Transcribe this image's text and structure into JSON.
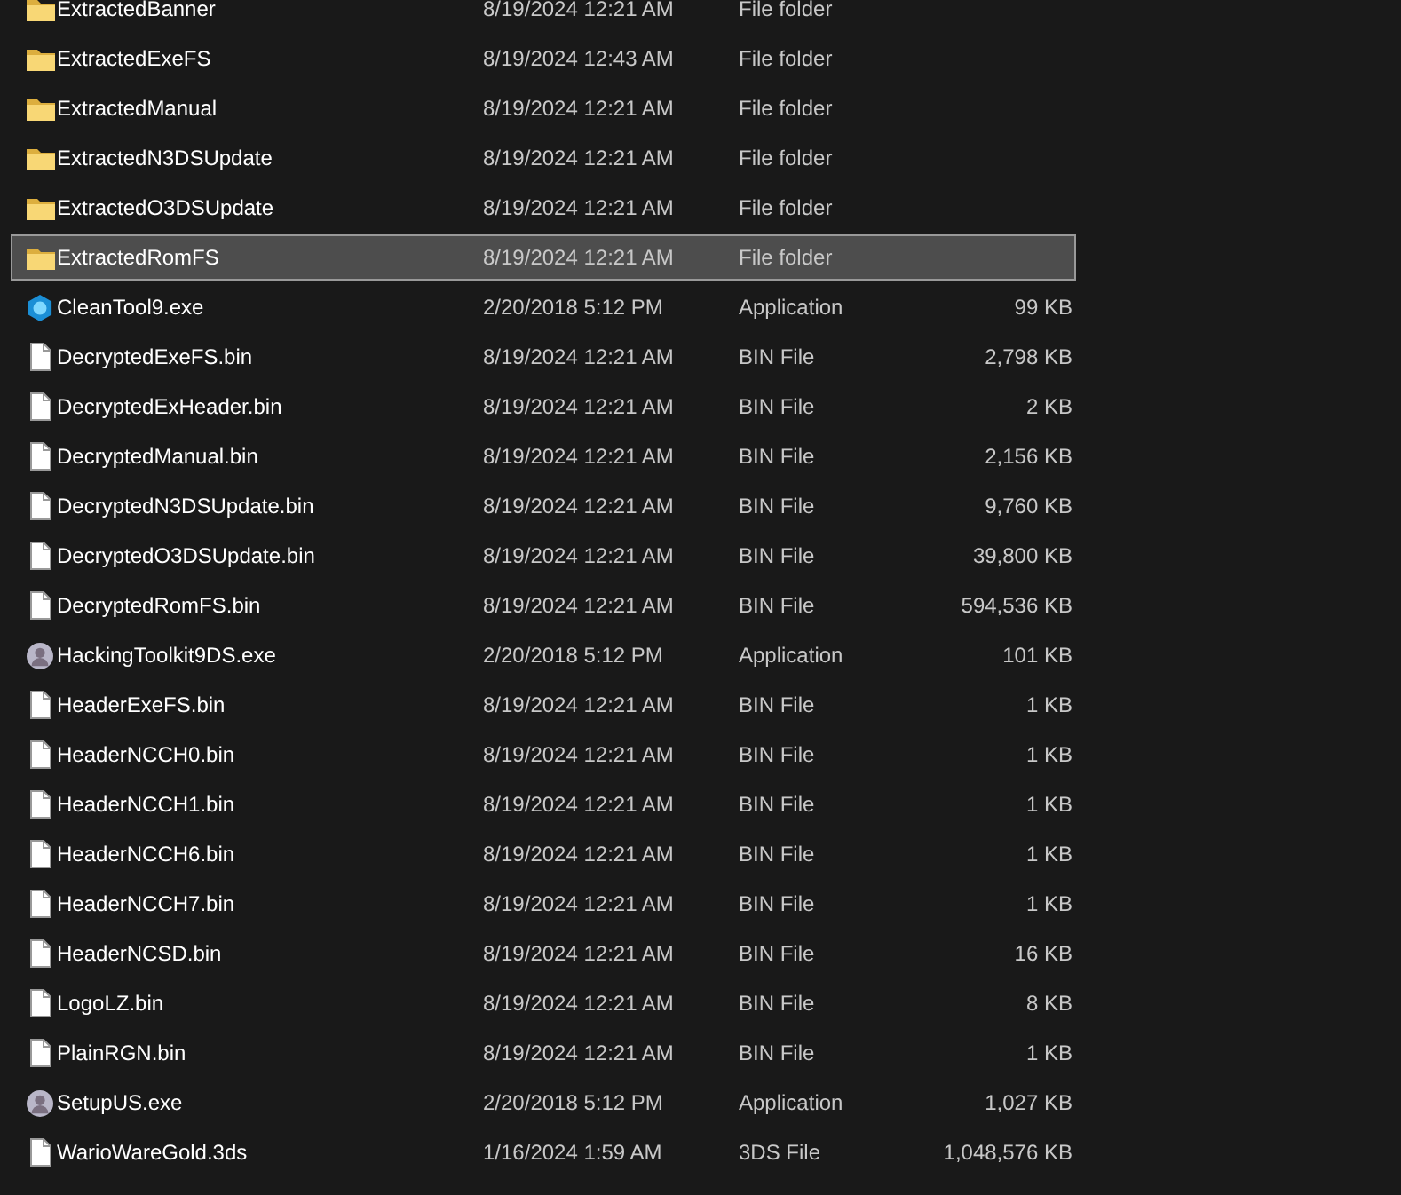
{
  "files": [
    {
      "name": "ExtractedBanner",
      "date": "8/19/2024 12:21 AM",
      "type": "File folder",
      "kind": "folder",
      "selected": false
    },
    {
      "name": "ExtractedExeFS",
      "date": "8/19/2024 12:43 AM",
      "type": "File folder",
      "kind": "folder",
      "selected": false
    },
    {
      "name": "ExtractedManual",
      "date": "8/19/2024 12:21 AM",
      "type": "File folder",
      "kind": "folder",
      "selected": false
    },
    {
      "name": "ExtractedN3DSUpdate",
      "date": "8/19/2024 12:21 AM",
      "type": "File folder",
      "kind": "folder",
      "selected": false
    },
    {
      "name": "ExtractedO3DSUpdate",
      "date": "8/19/2024 12:21 AM",
      "type": "File folder",
      "kind": "folder",
      "selected": false
    },
    {
      "name": "ExtractedRomFS",
      "date": "8/19/2024 12:21 AM",
      "type": "File folder",
      "kind": "folder",
      "selected": true
    },
    {
      "name": "CleanTool9.exe",
      "date": "2/20/2018 5:12 PM",
      "type": "Application",
      "size": "99 KB",
      "kind": "gem",
      "selected": false
    },
    {
      "name": "DecryptedExeFS.bin",
      "date": "8/19/2024 12:21 AM",
      "type": "BIN File",
      "size": "2,798 KB",
      "kind": "file",
      "selected": false
    },
    {
      "name": "DecryptedExHeader.bin",
      "date": "8/19/2024 12:21 AM",
      "type": "BIN File",
      "size": "2 KB",
      "kind": "file",
      "selected": false
    },
    {
      "name": "DecryptedManual.bin",
      "date": "8/19/2024 12:21 AM",
      "type": "BIN File",
      "size": "2,156 KB",
      "kind": "file",
      "selected": false
    },
    {
      "name": "DecryptedN3DSUpdate.bin",
      "date": "8/19/2024 12:21 AM",
      "type": "BIN File",
      "size": "9,760 KB",
      "kind": "file",
      "selected": false
    },
    {
      "name": "DecryptedO3DSUpdate.bin",
      "date": "8/19/2024 12:21 AM",
      "type": "BIN File",
      "size": "39,800 KB",
      "kind": "file",
      "selected": false
    },
    {
      "name": "DecryptedRomFS.bin",
      "date": "8/19/2024 12:21 AM",
      "type": "BIN File",
      "size": "594,536 KB",
      "kind": "file",
      "selected": false
    },
    {
      "name": "HackingToolkit9DS.exe",
      "date": "2/20/2018 5:12 PM",
      "type": "Application",
      "size": "101 KB",
      "kind": "avatar",
      "selected": false
    },
    {
      "name": "HeaderExeFS.bin",
      "date": "8/19/2024 12:21 AM",
      "type": "BIN File",
      "size": "1 KB",
      "kind": "file",
      "selected": false
    },
    {
      "name": "HeaderNCCH0.bin",
      "date": "8/19/2024 12:21 AM",
      "type": "BIN File",
      "size": "1 KB",
      "kind": "file",
      "selected": false
    },
    {
      "name": "HeaderNCCH1.bin",
      "date": "8/19/2024 12:21 AM",
      "type": "BIN File",
      "size": "1 KB",
      "kind": "file",
      "selected": false
    },
    {
      "name": "HeaderNCCH6.bin",
      "date": "8/19/2024 12:21 AM",
      "type": "BIN File",
      "size": "1 KB",
      "kind": "file",
      "selected": false
    },
    {
      "name": "HeaderNCCH7.bin",
      "date": "8/19/2024 12:21 AM",
      "type": "BIN File",
      "size": "1 KB",
      "kind": "file",
      "selected": false
    },
    {
      "name": "HeaderNCSD.bin",
      "date": "8/19/2024 12:21 AM",
      "type": "BIN File",
      "size": "16 KB",
      "kind": "file",
      "selected": false
    },
    {
      "name": "LogoLZ.bin",
      "date": "8/19/2024 12:21 AM",
      "type": "BIN File",
      "size": "8 KB",
      "kind": "file",
      "selected": false
    },
    {
      "name": "PlainRGN.bin",
      "date": "8/19/2024 12:21 AM",
      "type": "BIN File",
      "size": "1 KB",
      "kind": "file",
      "selected": false
    },
    {
      "name": "SetupUS.exe",
      "date": "2/20/2018 5:12 PM",
      "type": "Application",
      "size": "1,027 KB",
      "kind": "avatar",
      "selected": false
    },
    {
      "name": "WarioWareGold.3ds",
      "date": "1/16/2024 1:59 AM",
      "type": "3DS File",
      "size": "1,048,576 KB",
      "kind": "file",
      "selected": false
    }
  ]
}
